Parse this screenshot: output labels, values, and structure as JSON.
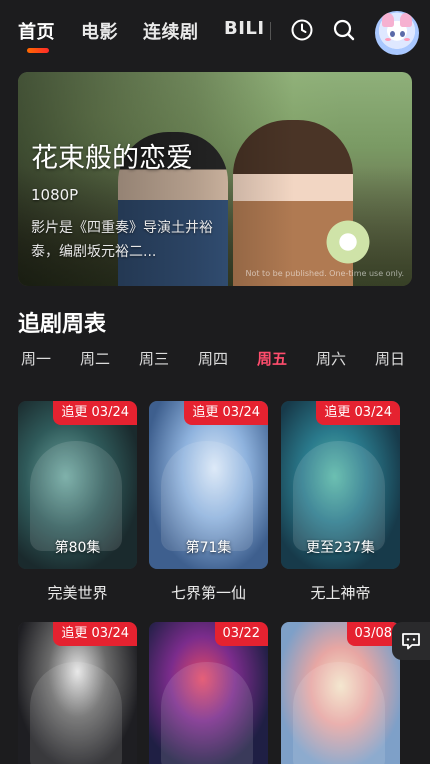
{
  "nav": {
    "tabs": [
      "首页",
      "电影",
      "连续剧",
      "BILI"
    ],
    "active_index": 0,
    "icons": [
      "history-icon",
      "search-icon",
      "avatar"
    ]
  },
  "banner": {
    "title": "花束般的恋爱",
    "quality": "1080P",
    "description": "影片是《四重奏》导演土井裕泰，编剧坂元裕二...",
    "watermark": "Not to be published. One-time use only."
  },
  "schedule": {
    "title": "追剧周表",
    "days": [
      "周一",
      "周二",
      "周三",
      "周四",
      "周五",
      "周六",
      "周日"
    ],
    "active_day": "周五",
    "accent": "#ff4d6d"
  },
  "cards": [
    {
      "badge": "追更 03/24",
      "episode": "第80集",
      "title": "完美世界"
    },
    {
      "badge": "追更 03/24",
      "episode": "第71集",
      "title": "七界第一仙"
    },
    {
      "badge": "追更 03/24",
      "episode": "更至237集",
      "title": "无上神帝"
    },
    {
      "badge": "追更 03/24",
      "episode": "",
      "title": ""
    },
    {
      "badge": "03/22",
      "episode": "",
      "title": ""
    },
    {
      "badge": "03/08",
      "episode": "",
      "title": ""
    }
  ],
  "colors": {
    "background": "#1c1c1e",
    "badge": "#e52230",
    "underline_start": "#ff6a00",
    "underline_end": "#ff2a2a"
  }
}
